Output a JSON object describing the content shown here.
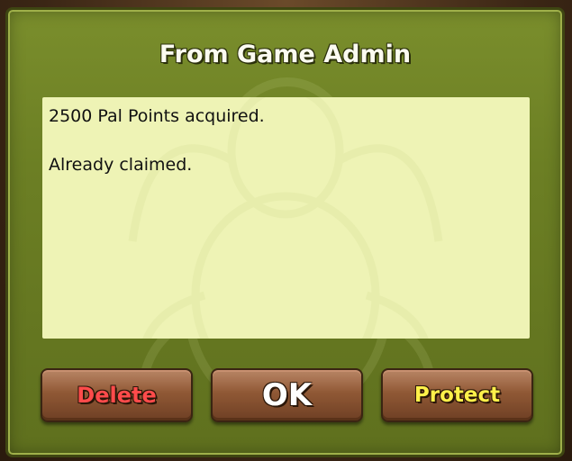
{
  "dialog": {
    "title": "From Game Admin",
    "message_lines": [
      "2500 Pal Points acquired.",
      "Already claimed."
    ]
  },
  "buttons": {
    "delete_label": "Delete",
    "ok_label": "OK",
    "protect_label": "Protect"
  },
  "colors": {
    "panel": "#6c7f24",
    "message_bg": "#eef3b5",
    "delete_text": "#ff4b4b",
    "ok_text": "#ffffff",
    "protect_text": "#fff04a",
    "button": "#8a5432"
  },
  "icons": {
    "background_emblem": "scarab-emblem-icon"
  }
}
